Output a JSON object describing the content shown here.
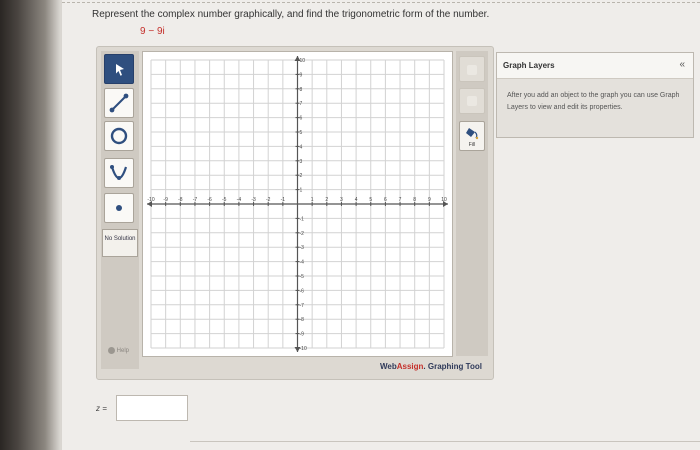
{
  "question": {
    "prompt": "Represent the complex number graphically, and find the trigonometric form of the number.",
    "complex_number": "9 − 9i"
  },
  "toolbar": {
    "tools": [
      {
        "name": "tool-pointer",
        "icon": "pointer-arrow-icon",
        "selected": true
      },
      {
        "name": "tool-line",
        "icon": "line-segment-icon"
      },
      {
        "name": "tool-circle",
        "icon": "circle-icon"
      },
      {
        "name": "tool-parabola",
        "icon": "parabola-icon"
      },
      {
        "name": "tool-point",
        "icon": "point-icon"
      }
    ],
    "no_solution_label": "No Solution",
    "help_label": "Help"
  },
  "side_tools": {
    "fill_label": "Fill",
    "delete_icon": "delete-icon",
    "undo_icon": "undo-icon",
    "fill_icon": "fill-bucket-icon"
  },
  "graph": {
    "x_range": [
      -10,
      10
    ],
    "y_range": [
      -10,
      10
    ],
    "grid_step": 1,
    "x_tick_labels": [
      "-10",
      "-9",
      "-8",
      "-7",
      "-6",
      "-5",
      "-4",
      "-3",
      "-2",
      "-1",
      "1",
      "2",
      "3",
      "4",
      "5",
      "6",
      "7",
      "8",
      "9",
      "10"
    ],
    "y_tick_labels": [
      "10",
      "9",
      "8",
      "7",
      "6",
      "5",
      "4",
      "3",
      "2",
      "1",
      "-1",
      "-2",
      "-3",
      "-4",
      "-5",
      "-6",
      "-7",
      "-8",
      "-9",
      "-10"
    ]
  },
  "branding": {
    "brand_main": "Web",
    "brand_accent": "Assign",
    "suffix": ". Graphing Tool"
  },
  "layers": {
    "title": "Graph Layers",
    "collapse_icon": "«",
    "body": "After you add an object to the graph you can use Graph Layers to view and edit its properties."
  },
  "answer": {
    "label": "z =",
    "value": ""
  },
  "colors": {
    "accent_red": "#c4302b",
    "selected_tool": "#2f4f7f",
    "grid_line": "#d2d2d2",
    "axis": "#555555"
  }
}
